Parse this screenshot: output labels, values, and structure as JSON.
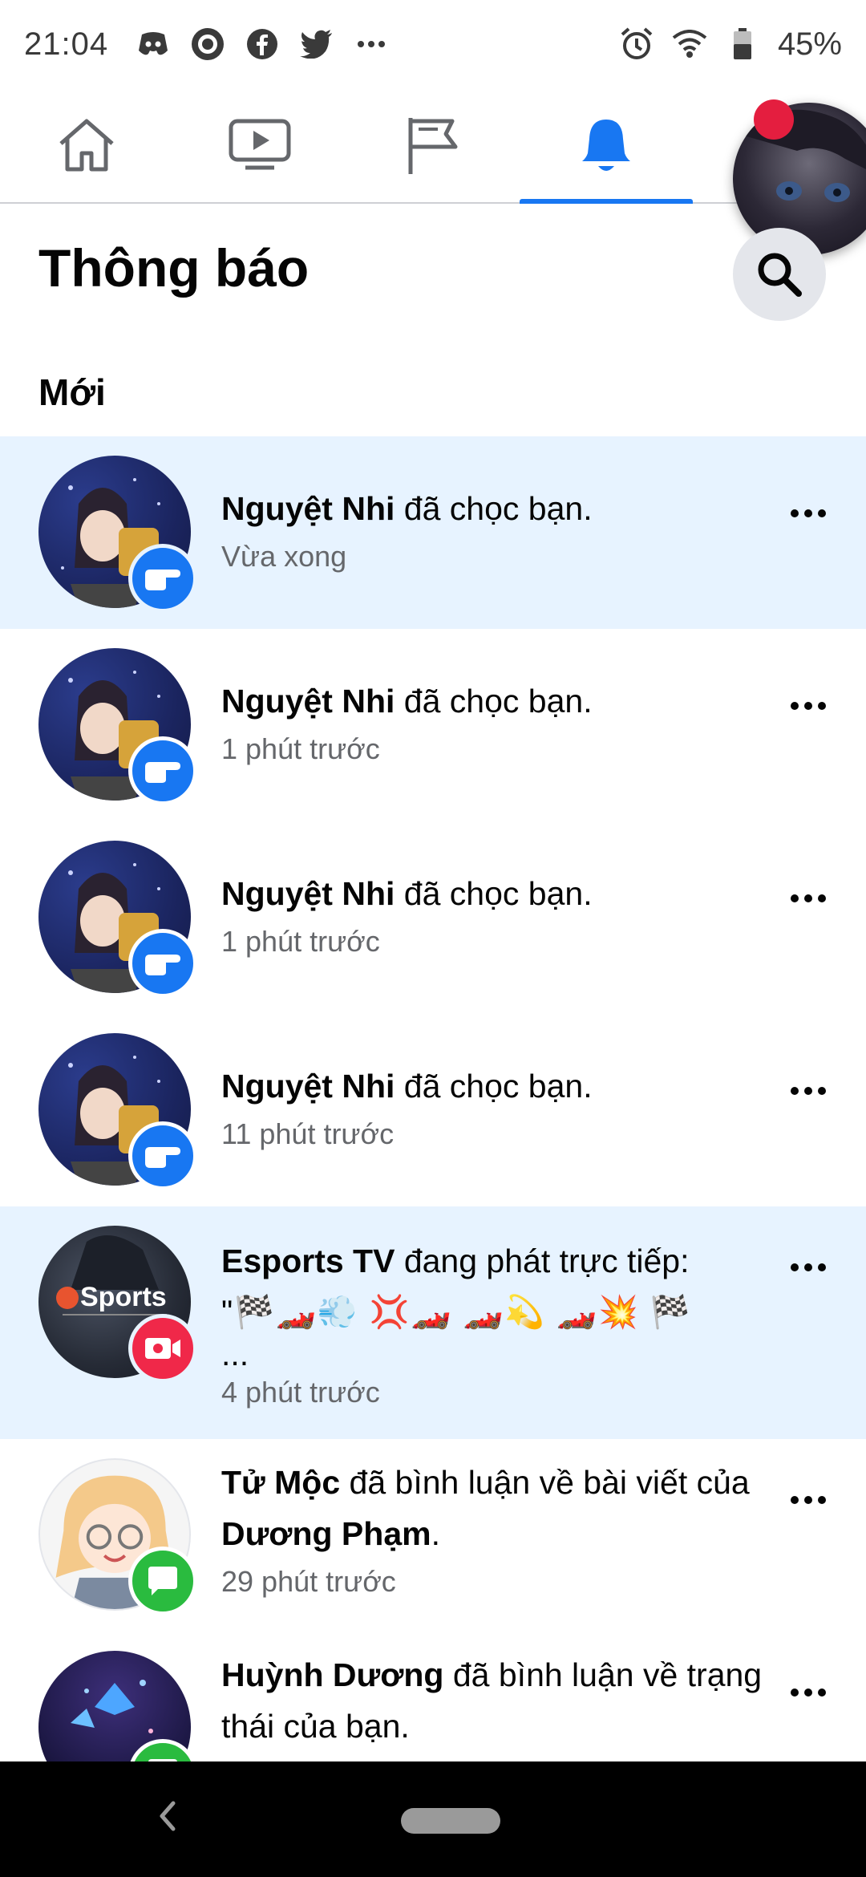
{
  "status_bar": {
    "time": "21:04",
    "left_icons": [
      "discord-icon",
      "app-icon",
      "facebook-icon",
      "twitter-icon",
      "more-icon"
    ],
    "right_icons": [
      "alarm-icon",
      "wifi-icon",
      "battery-icon"
    ],
    "battery": "45%"
  },
  "top_nav": {
    "tabs": [
      "home-icon",
      "video-icon",
      "flag-icon",
      "bell-icon"
    ],
    "active_tab": "bell-icon",
    "accent_color": "#1877f2"
  },
  "header": {
    "title": "Thông báo"
  },
  "section": {
    "label": "Mới"
  },
  "notifications": [
    {
      "actor": "Nguyệt Nhi",
      "action": " đã chọc bạn.",
      "time": "Vừa xong",
      "badge": "poke",
      "unread": true
    },
    {
      "actor": "Nguyệt Nhi",
      "action": " đã chọc bạn.",
      "time": "1 phút trước",
      "badge": "poke",
      "unread": false
    },
    {
      "actor": "Nguyệt Nhi",
      "action": " đã chọc bạn.",
      "time": "1 phút trước",
      "badge": "poke",
      "unread": false
    },
    {
      "actor": "Nguyệt Nhi",
      "action": " đã chọc bạn.",
      "time": "11 phút trước",
      "badge": "poke",
      "unread": false
    },
    {
      "actor": "Esports TV",
      "action": " đang phát trực tiếp:",
      "extra": "\"🏁🏎️💨 💢🏎️ 🏎️💫 🏎️💥 🏁",
      "extra2": "...",
      "time": "4 phút trước",
      "badge": "live",
      "unread": true
    },
    {
      "actor": "Tử Mộc",
      "action": " đã bình luận về bài viết của ",
      "target": "Dương Phạm",
      "tail": ".",
      "time": "29 phút trước",
      "badge": "comment",
      "unread": false
    },
    {
      "actor": "Huỳnh Dương",
      "action": " đã bình luận về trạng thái của bạn.",
      "badge": "comment",
      "unread": false
    }
  ]
}
